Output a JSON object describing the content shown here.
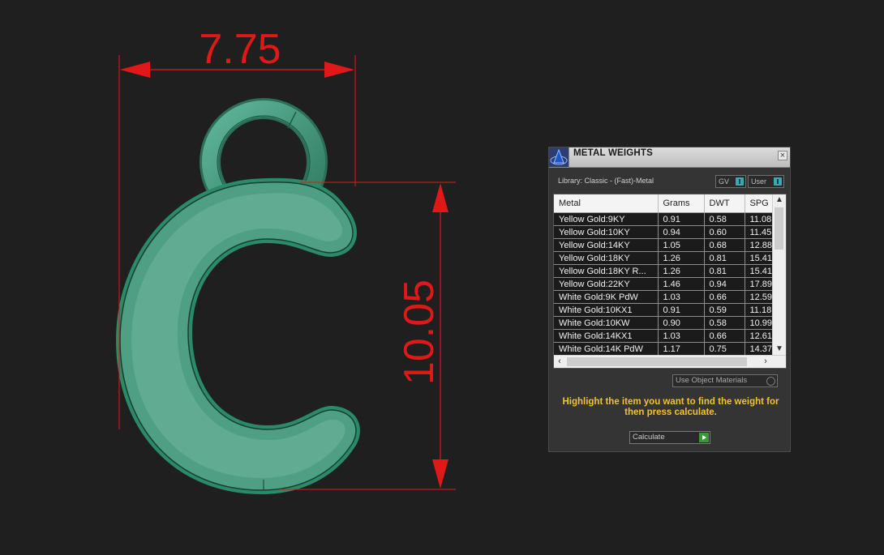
{
  "viewport": {
    "dimensions": {
      "width": "7.75",
      "height": "10.05"
    },
    "colors": {
      "dimension": "#e01818",
      "model": "#3c8f6f"
    }
  },
  "panel": {
    "title": "METAL WEIGHTS",
    "close_label": "×",
    "library_label": "Library: Classic - (Fast)-Metal",
    "gv_toggle": "GV",
    "user_toggle": "User",
    "columns": [
      "Metal",
      "Grams",
      "DWT",
      "SPG"
    ],
    "rows": [
      {
        "metal": "Yellow Gold:9KY",
        "grams": "0.91",
        "dwt": "0.58",
        "spg": "11.08"
      },
      {
        "metal": "Yellow Gold:10KY",
        "grams": "0.94",
        "dwt": "0.60",
        "spg": "11.45"
      },
      {
        "metal": "Yellow Gold:14KY",
        "grams": "1.05",
        "dwt": "0.68",
        "spg": "12.88"
      },
      {
        "metal": "Yellow Gold:18KY",
        "grams": "1.26",
        "dwt": "0.81",
        "spg": "15.41"
      },
      {
        "metal": "Yellow Gold:18KY R...",
        "grams": "1.26",
        "dwt": "0.81",
        "spg": "15.41"
      },
      {
        "metal": "Yellow Gold:22KY",
        "grams": "1.46",
        "dwt": "0.94",
        "spg": "17.89"
      },
      {
        "metal": "White Gold:9K PdW",
        "grams": "1.03",
        "dwt": "0.66",
        "spg": "12.59"
      },
      {
        "metal": "White Gold:10KX1",
        "grams": "0.91",
        "dwt": "0.59",
        "spg": "11.18"
      },
      {
        "metal": "White Gold:10KW",
        "grams": "0.90",
        "dwt": "0.58",
        "spg": "10.99"
      },
      {
        "metal": "White Gold:14KX1",
        "grams": "1.03",
        "dwt": "0.66",
        "spg": "12.61"
      },
      {
        "metal": "White Gold:14K PdW",
        "grams": "1.17",
        "dwt": "0.75",
        "spg": "14.37"
      }
    ],
    "use_object_materials": "Use Object Materials",
    "instruction": "Highlight the item you want to find the weight for then press calculate.",
    "calculate_label": "Calculate",
    "colors": {
      "accent": "#f1c232",
      "toggle": "#3aa9b5",
      "go": "#3a9a3a"
    }
  }
}
